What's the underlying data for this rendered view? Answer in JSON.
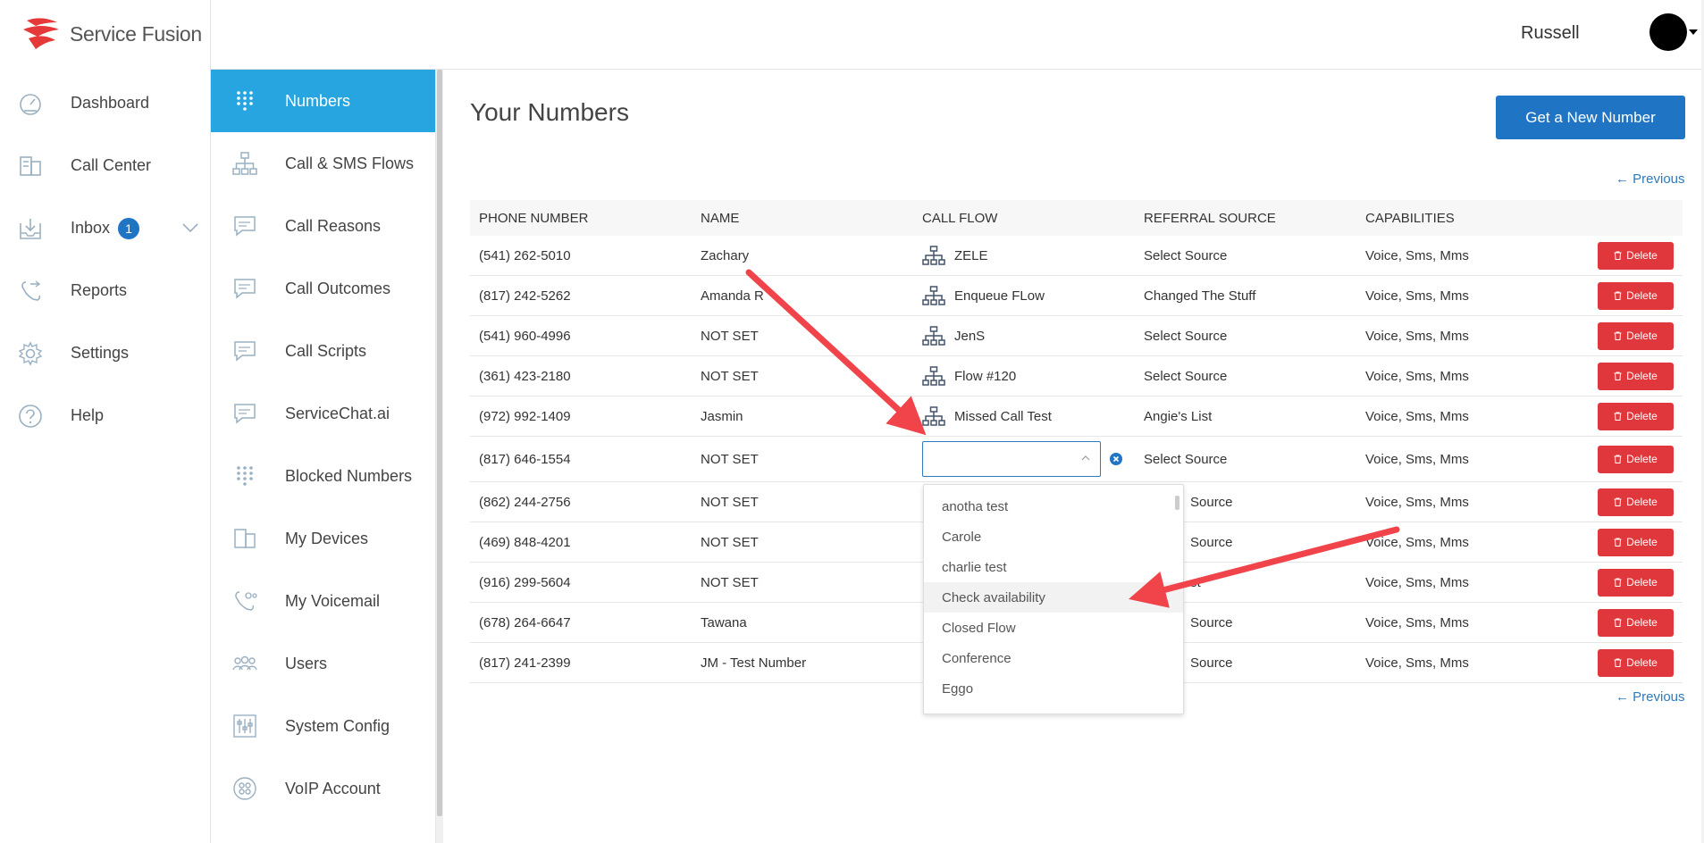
{
  "app": {
    "brand": "Service Fusion"
  },
  "colors": {
    "accent": "#26a5e1",
    "primary": "#1f74c3",
    "danger": "#e0373c",
    "arrow": "#f0434a"
  },
  "nav": {
    "items": [
      {
        "label": "Dashboard",
        "icon": "dashboard-icon"
      },
      {
        "label": "Call Center",
        "icon": "call-center-icon"
      },
      {
        "label": "Inbox",
        "icon": "inbox-icon",
        "badge": "1"
      },
      {
        "label": "Reports",
        "icon": "reports-icon"
      },
      {
        "label": "Settings",
        "icon": "settings-icon"
      },
      {
        "label": "Help",
        "icon": "help-icon"
      }
    ]
  },
  "subnav": {
    "items": [
      {
        "label": "Numbers",
        "icon": "keypad-icon",
        "active": true
      },
      {
        "label": "Call & SMS Flows",
        "icon": "flow-icon"
      },
      {
        "label": "Call Reasons",
        "icon": "comment-icon"
      },
      {
        "label": "Call Outcomes",
        "icon": "comment-icon"
      },
      {
        "label": "Call Scripts",
        "icon": "comment-icon"
      },
      {
        "label": "ServiceChat.ai",
        "icon": "comment-icon"
      },
      {
        "label": "Blocked Numbers",
        "icon": "keypad-icon"
      },
      {
        "label": "My Devices",
        "icon": "devices-icon"
      },
      {
        "label": "My Voicemail",
        "icon": "voicemail-icon"
      },
      {
        "label": "Users",
        "icon": "users-icon"
      },
      {
        "label": "System Config",
        "icon": "sliders-icon"
      },
      {
        "label": "VoIP Account",
        "icon": "voip-icon"
      }
    ]
  },
  "header": {
    "username": "Russell"
  },
  "main": {
    "title": "Your Numbers",
    "new_number_button": "Get a New Number",
    "previous_link": "← Previous",
    "columns": [
      "PHONE NUMBER",
      "NAME",
      "CALL FLOW",
      "REFERRAL SOURCE",
      "CAPABILITIES"
    ],
    "delete_label": "Delete",
    "rows": [
      {
        "phone": "(541) 262-5010",
        "name": "Zachary",
        "flow": "ZELE",
        "source": "Select Source",
        "caps": "Voice, Sms, Mms"
      },
      {
        "phone": "(817) 242-5262",
        "name": "Amanda R",
        "flow": "Enqueue FLow",
        "source": "Changed The Stuff",
        "caps": "Voice, Sms, Mms"
      },
      {
        "phone": "(541) 960-4996",
        "name": "NOT SET",
        "flow": "JenS",
        "source": "Select Source",
        "caps": "Voice, Sms, Mms"
      },
      {
        "phone": "(361) 423-2180",
        "name": "NOT SET",
        "flow": "Flow #120",
        "source": "Select Source",
        "caps": "Voice, Sms, Mms"
      },
      {
        "phone": "(972) 992-1409",
        "name": "Jasmin",
        "flow": "Missed Call Test",
        "source": "Angie's List",
        "caps": "Voice, Sms, Mms"
      },
      {
        "phone": "(817) 646-1554",
        "name": "NOT SET",
        "flow": "",
        "source": "Select Source",
        "caps": "Voice, Sms, Mms"
      },
      {
        "phone": "(862) 244-2756",
        "name": "NOT SET",
        "flow": "",
        "source": "Source",
        "caps": "Voice, Sms, Mms"
      },
      {
        "phone": "(469) 848-4201",
        "name": "NOT SET",
        "flow": "",
        "source": "Source",
        "caps": "Voice, Sms, Mms"
      },
      {
        "phone": "(916) 299-5604",
        "name": "NOT SET",
        "flow": "",
        "source": "st",
        "caps": "Voice, Sms, Mms"
      },
      {
        "phone": "(678) 264-6647",
        "name": "Tawana",
        "flow": "",
        "source": "Source",
        "caps": "Voice, Sms, Mms"
      },
      {
        "phone": "(817) 241-2399",
        "name": "JM - Test Number",
        "flow": "",
        "source": "Source",
        "caps": "Voice, Sms, Mms"
      }
    ],
    "dropdown": {
      "options": [
        "anotha test",
        "Carole",
        "charlie test",
        "Check availability",
        "Closed Flow",
        "Conference",
        "Eggo"
      ],
      "highlighted": "Check availability"
    }
  }
}
